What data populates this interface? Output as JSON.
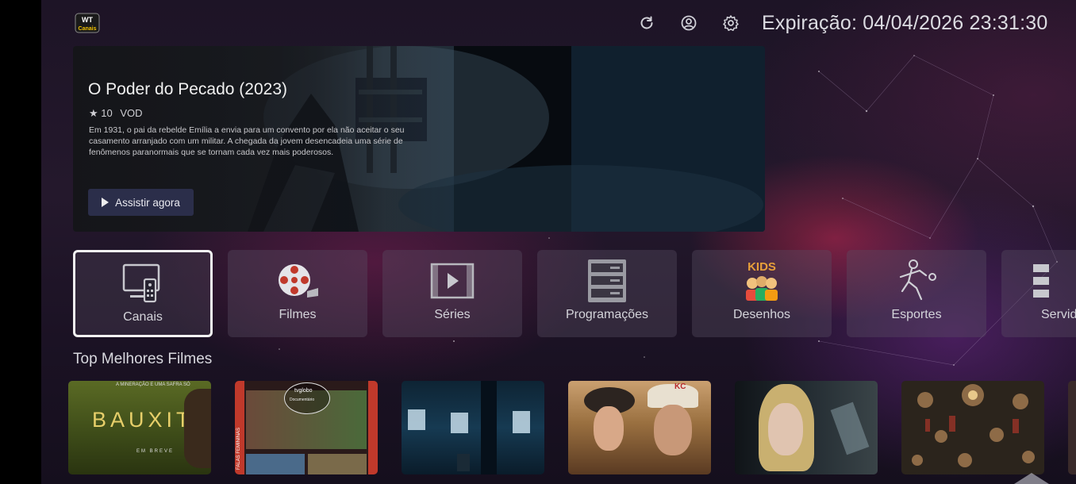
{
  "header": {
    "expiry_text": "Expiração: 04/04/2026 23:31:30",
    "logo_text_top": "WT",
    "logo_text_bottom": "Canais"
  },
  "hero": {
    "title": "O Poder do Pecado (2023)",
    "rating": "★ 10",
    "type": "VOD",
    "description": "Em 1931, o pai da rebelde Emília a envia para um convento por ela não aceitar o seu casamento arranjado com um militar. A chegada da jovem desencadeia uma série de fenômenos paranormais que se tornam cada vez mais poderosos.",
    "watch_label": "Assistir agora"
  },
  "categories": [
    {
      "label": "Canais",
      "icon": "tv-remote-icon",
      "selected": true
    },
    {
      "label": "Filmes",
      "icon": "film-reel-icon"
    },
    {
      "label": "Séries",
      "icon": "video-play-icon"
    },
    {
      "label": "Programações",
      "icon": "server-list-icon"
    },
    {
      "label": "Desenhos",
      "icon": "kids-icon",
      "badge": "KIDS"
    },
    {
      "label": "Esportes",
      "icon": "soccer-player-icon"
    },
    {
      "label": "Servid",
      "icon": "server-list-icon"
    }
  ],
  "top_movies": {
    "title": "Top Melhores Filmes",
    "posters": [
      {
        "name": "bauxita",
        "title": "BAUXITA",
        "tagline": "A MINERAÇÃO E UMA SAFRA SÓ",
        "footer": "EM BREVE",
        "bg": "#4a5a1e"
      },
      {
        "name": "falas-femininas",
        "side_text": "FALAS FEMININAS",
        "badge": "tvglobo",
        "badge_sub": "Documentário",
        "bg": "#2a1a1a"
      },
      {
        "name": "o-poder-do-pecado",
        "bg": "#0f2a3c"
      },
      {
        "name": "western-couple",
        "corner": "KC",
        "bg": "#7a5a3a"
      },
      {
        "name": "blonde-woman",
        "bg": "#1c2226"
      },
      {
        "name": "pattern-art",
        "bg": "#2b241c"
      }
    ]
  },
  "colors": {
    "button_bg": "#2b2e4a",
    "tile_bg": "rgba(90,80,100,0.38)",
    "selected_border": "#f2f2f2"
  }
}
